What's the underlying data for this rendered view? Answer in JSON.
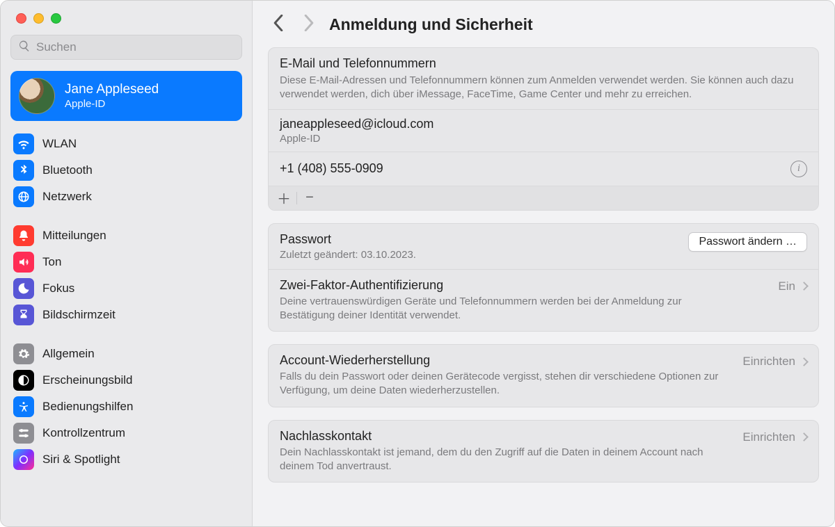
{
  "search": {
    "placeholder": "Suchen"
  },
  "profile": {
    "name": "Jane Appleseed",
    "sub": "Apple-ID"
  },
  "sidebar": {
    "g1": [
      {
        "label": "WLAN"
      },
      {
        "label": "Bluetooth"
      },
      {
        "label": "Netzwerk"
      }
    ],
    "g2": [
      {
        "label": "Mitteilungen"
      },
      {
        "label": "Ton"
      },
      {
        "label": "Fokus"
      },
      {
        "label": "Bildschirmzeit"
      }
    ],
    "g3": [
      {
        "label": "Allgemein"
      },
      {
        "label": "Erscheinungsbild"
      },
      {
        "label": "Bedienungshilfen"
      },
      {
        "label": "Kontrollzentrum"
      },
      {
        "label": "Siri & Spotlight"
      }
    ]
  },
  "header": {
    "title": "Anmeldung und Sicherheit"
  },
  "contacts": {
    "title": "E-Mail und Telefonnummern",
    "desc": "Diese E-Mail-Adressen und Telefonnummern können zum Anmelden verwendet werden. Sie können auch dazu verwendet werden, dich über iMessage, FaceTime, Game Center und mehr zu erreichen.",
    "email": "janeappleseed@icloud.com",
    "email_sub": "Apple-ID",
    "phone": "+1 (408) 555-0909"
  },
  "password": {
    "title": "Passwort",
    "sub": "Zuletzt geändert: 03.10.2023.",
    "button": "Passwort ändern …"
  },
  "twofa": {
    "title": "Zwei-Faktor-Authentifizierung",
    "desc": "Deine vertrauenswürdigen Geräte und Telefonnummern werden bei der Anmeldung zur Bestätigung deiner Identität verwendet.",
    "status": "Ein"
  },
  "recovery": {
    "title": "Account-Wiederherstellung",
    "desc": "Falls du dein Passwort oder deinen Gerätecode vergisst, stehen dir verschiedene Optionen zur Verfügung, um deine Daten wiederherzustellen.",
    "status": "Einrichten"
  },
  "legacy": {
    "title": "Nachlasskontakt",
    "desc": "Dein Nachlasskontakt ist jemand, dem du den Zugriff auf die Daten in deinem Account nach deinem Tod anvertraust.",
    "status": "Einrichten"
  }
}
